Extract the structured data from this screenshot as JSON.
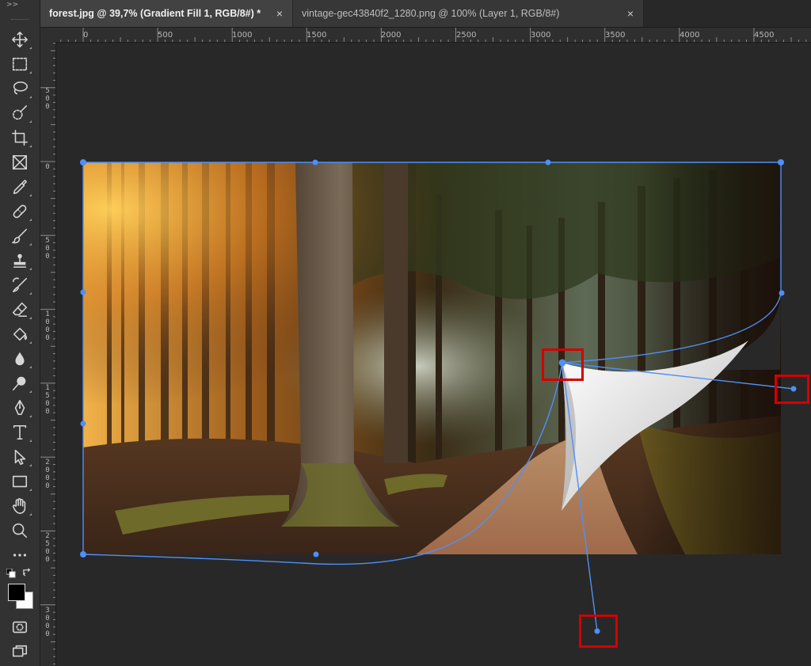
{
  "toolbar": {
    "expand_label": ">>",
    "tools": [
      {
        "name": "move-tool-icon"
      },
      {
        "name": "marquee-tool-icon"
      },
      {
        "name": "lasso-tool-icon"
      },
      {
        "name": "quick-selection-tool-icon"
      },
      {
        "name": "crop-tool-icon"
      },
      {
        "name": "frame-tool-icon"
      },
      {
        "name": "eyedropper-tool-icon"
      },
      {
        "name": "healing-brush-tool-icon"
      },
      {
        "name": "brush-tool-icon"
      },
      {
        "name": "clone-stamp-tool-icon"
      },
      {
        "name": "history-brush-tool-icon"
      },
      {
        "name": "eraser-tool-icon"
      },
      {
        "name": "paint-bucket-tool-icon"
      },
      {
        "name": "blur-tool-icon"
      },
      {
        "name": "dodge-tool-icon"
      },
      {
        "name": "pen-tool-icon"
      },
      {
        "name": "type-tool-icon"
      },
      {
        "name": "path-selection-tool-icon"
      },
      {
        "name": "rectangle-tool-icon"
      },
      {
        "name": "hand-tool-icon"
      },
      {
        "name": "zoom-tool-icon"
      },
      {
        "name": "more-tools-icon"
      }
    ],
    "foreground_color": "#000000",
    "background_color": "#ffffff"
  },
  "tabs": [
    {
      "label": "forest.jpg @ 39,7% (Gradient Fill 1, RGB/8#) *",
      "close": "×",
      "active": true
    },
    {
      "label": "vintage-gec43840f2_1280.png @ 100% (Layer 1, RGB/8#)",
      "close": "×",
      "active": false
    }
  ],
  "rulers": {
    "top_labels": [
      "0",
      "500",
      "1000",
      "1500",
      "2000",
      "2500",
      "3000",
      "3500",
      "4000",
      "4500"
    ],
    "left_labels": [
      "500",
      "0",
      "500",
      "1000",
      "1500",
      "2000",
      "2500",
      "3000"
    ]
  },
  "colors": {
    "accent_transform": "#4f8ff7",
    "highlight": "#d40000",
    "app_bg": "#282828",
    "panel_bg": "#323232"
  }
}
